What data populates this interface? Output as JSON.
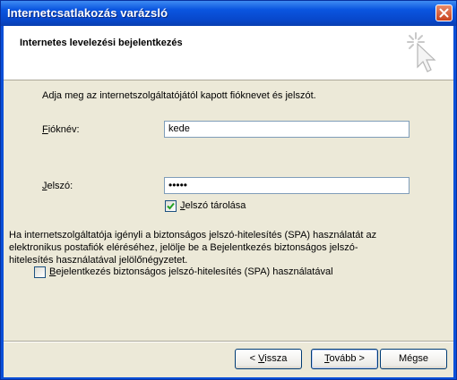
{
  "window": {
    "title": "Internetcsatlakozás varázsló"
  },
  "header": {
    "heading": "Internetes levelezési bejelentkezés"
  },
  "intro": "Adja meg az internetszolgáltatójától kapott fióknevet és jelszót.",
  "account": {
    "label_mnemonic": "F",
    "label_rest": "ióknév:",
    "value": "kede"
  },
  "password": {
    "label_mnemonic": "J",
    "label_rest": "elszó:",
    "value": "•••••"
  },
  "remember": {
    "label_mnemonic": "J",
    "label_rest": "elszó tárolása",
    "checked": true
  },
  "spa_info": "Ha internetszolgáltatója igényli a biztonságos jelszó-hitelesítés (SPA) használatát az elektronikus postafiók eléréséhez, jelölje be a Bejelentkezés biztonságos jelszó-hitelesítés használatával jelölőnégyzetet.",
  "spa_checkbox": {
    "label_mnemonic": "B",
    "label_rest": "ejelentkezés biztonságos jelszó-hitelesítés (SPA) használatával",
    "checked": false
  },
  "buttons": {
    "back_prefix": "< ",
    "back_mnemonic": "V",
    "back_rest": "issza",
    "next_mnemonic": "T",
    "next_rest": "ovább >",
    "cancel": "Mégse"
  },
  "icons": {
    "close": "close-icon",
    "wizard": "wizard-cursor-icon",
    "check": "checkmark-icon"
  }
}
